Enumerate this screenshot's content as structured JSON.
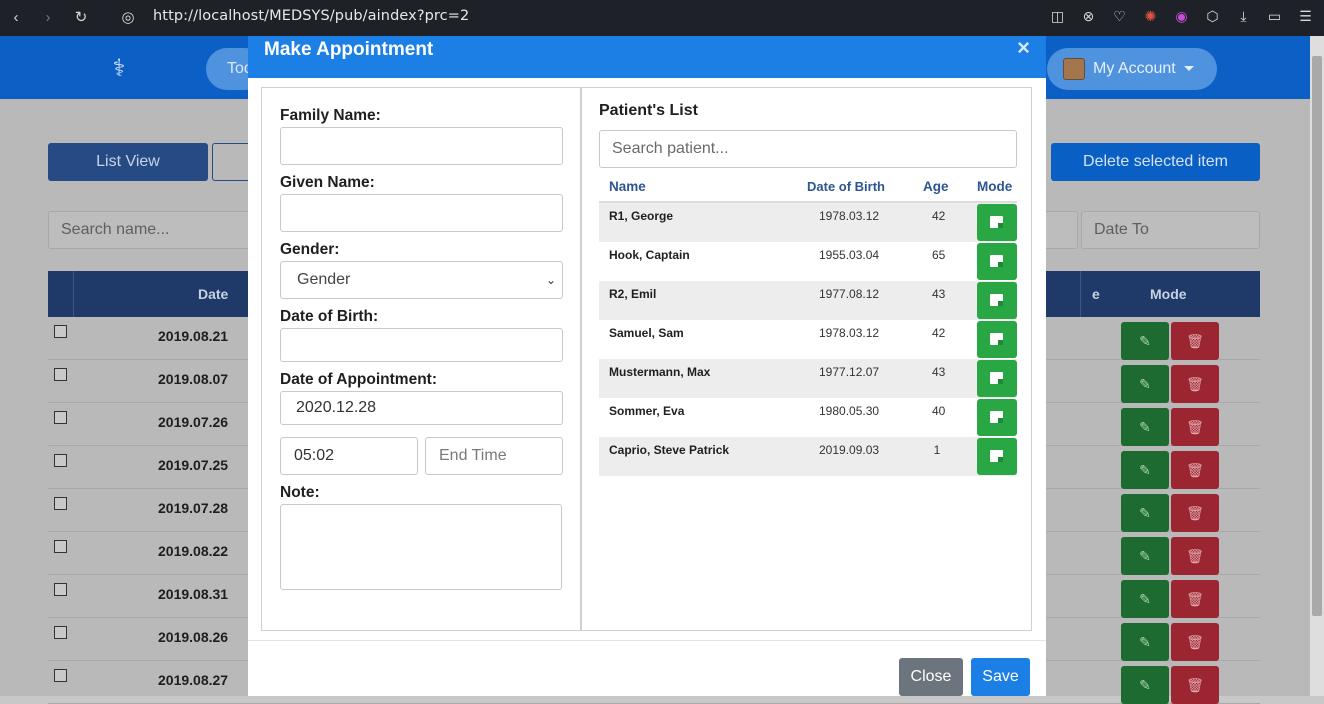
{
  "browser": {
    "url": "http://localhost/MEDSYS/pub/aindex?prc=2",
    "icons": [
      "back-icon",
      "forward-icon",
      "reload-icon",
      "globe-icon",
      "camera-icon",
      "block-icon",
      "heart-icon",
      "color-icon",
      "palette-icon",
      "box-icon",
      "download-icon",
      "battery-icon",
      "menu-icon"
    ]
  },
  "header": {
    "pill_label": "Tod",
    "account_label": "My Account"
  },
  "toolbar": {
    "list_view_label": "List View",
    "delete_selected_label": "Delete selected item",
    "search_placeholder": "Search name...",
    "date_to_placeholder": "Date To"
  },
  "table": {
    "headers": {
      "date": "Date",
      "partial": "e",
      "mode": "Mode"
    },
    "rows": [
      {
        "date": "2019.08.21"
      },
      {
        "date": "2019.08.07"
      },
      {
        "date": "2019.07.26"
      },
      {
        "date": "2019.07.25"
      },
      {
        "date": "2019.07.28"
      },
      {
        "date": "2019.08.22"
      },
      {
        "date": "2019.08.31"
      },
      {
        "date": "2019.08.26"
      },
      {
        "date": "2019.08.27"
      }
    ]
  },
  "modal": {
    "title": "Make Appointment",
    "close_symbol": "×",
    "form": {
      "family_name_label": "Family Name:",
      "family_name_value": "",
      "given_name_label": "Given Name:",
      "given_name_value": "",
      "gender_label": "Gender:",
      "gender_value": "Gender",
      "dob_label": "Date of Birth:",
      "dob_value": "",
      "appointment_date_label": "Date of Appointment:",
      "appointment_date_value": "2020.12.28",
      "start_time_value": "05:02",
      "end_time_placeholder": "End Time",
      "note_label": "Note:",
      "note_value": ""
    },
    "patients": {
      "title": "Patient's List",
      "search_placeholder": "Search patient...",
      "columns": {
        "name": "Name",
        "dob": "Date of Birth",
        "age": "Age",
        "mode": "Mode"
      },
      "rows": [
        {
          "name": "R1, George",
          "dob": "1978.03.12",
          "age": "42"
        },
        {
          "name": "Hook, Captain",
          "dob": "1955.03.04",
          "age": "65"
        },
        {
          "name": "R2, Emil",
          "dob": "1977.08.12",
          "age": "43"
        },
        {
          "name": "Samuel, Sam",
          "dob": "1978.03.12",
          "age": "42"
        },
        {
          "name": "Mustermann, Max",
          "dob": "1977.12.07",
          "age": "43"
        },
        {
          "name": "Sommer, Eva",
          "dob": "1980.05.30",
          "age": "40"
        },
        {
          "name": "Caprio, Steve Patrick",
          "dob": "2019.09.03",
          "age": "1"
        }
      ]
    },
    "footer": {
      "close_label": "Close",
      "save_label": "Save"
    }
  },
  "colors": {
    "modal_header": "#1b7fe6",
    "app_header": "#0b5fc5",
    "select_button": "#29a745",
    "close_button": "#6c757d"
  }
}
